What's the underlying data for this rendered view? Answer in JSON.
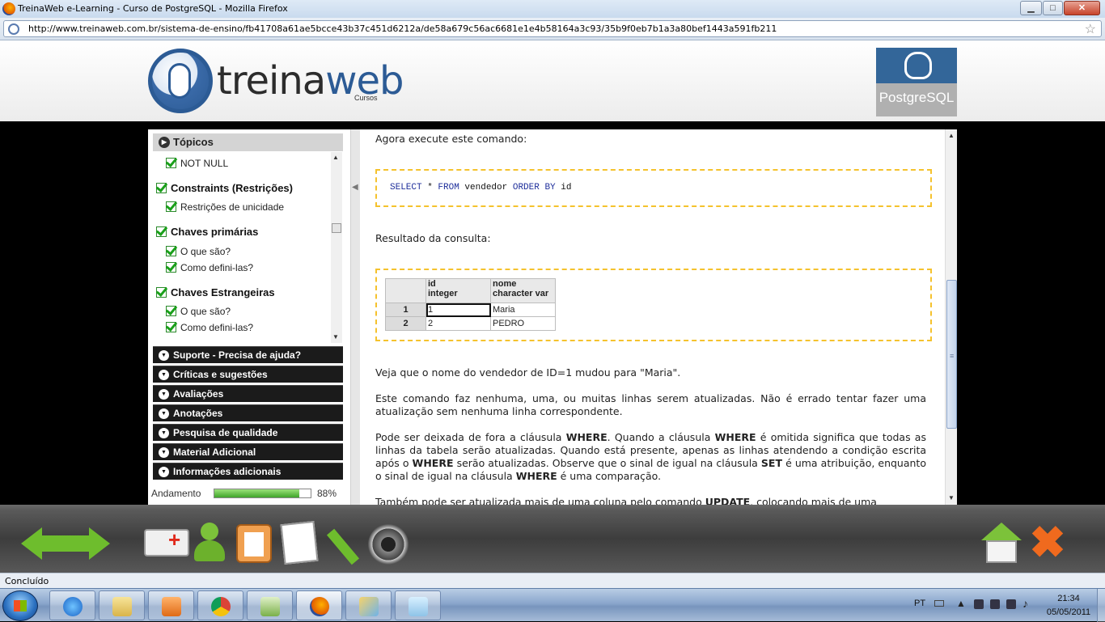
{
  "window": {
    "title": "TreinaWeb e-Learning - Curso de PostgreSQL - Mozilla Firefox",
    "minimize": "▁",
    "maximize": "□",
    "close": "✕"
  },
  "addressbar": {
    "url": "http://www.treinaweb.com.br/sistema-de-ensino/fb41708a61ae5bcce43b37c451d6212a/de58a679c56ac6681e1e4b58164a3c93/35b9f0eb7b1a3a80bef1443a591fb211",
    "bookmark_star": "☆"
  },
  "header": {
    "logo_text_1": "treina",
    "logo_text_2": "web",
    "logo_sub": "Cursos",
    "badge_label": "PostgreSQL"
  },
  "sidebar": {
    "topics_label": "Tópicos",
    "topics": [
      {
        "label": "NOT NULL",
        "group": false
      },
      {
        "label": "Constraints (Restrições)",
        "group": true
      },
      {
        "label": "Restrições de unicidade",
        "group": false
      },
      {
        "label": "Chaves primárias",
        "group": true
      },
      {
        "label": "O que são?",
        "group": false
      },
      {
        "label": "Como defini-las?",
        "group": false
      },
      {
        "label": "Chaves Estrangeiras",
        "group": true
      },
      {
        "label": "O que são?",
        "group": false
      },
      {
        "label": "Como defini-las?",
        "group": false
      }
    ],
    "sections": [
      "Suporte - Precisa de ajuda?",
      "Críticas e sugestões",
      "Avaliações",
      "Anotações",
      "Pesquisa de qualidade",
      "Material Adicional",
      "Informações adicionais"
    ],
    "progress_label": "Andamento",
    "progress_value": 88,
    "progress_text": "88%"
  },
  "content": {
    "intro": "Agora execute este comando:",
    "code": {
      "kw1": "SELECT",
      "rest1": " * ",
      "kw2": "FROM",
      "rest2": " vendedor ",
      "kw3": "ORDER BY",
      "rest3": " id"
    },
    "result_label": "Resultado da consulta:",
    "grid": {
      "columns": [
        {
          "name": "id",
          "type": "integer"
        },
        {
          "name": "nome",
          "type": "character var"
        }
      ],
      "rows": [
        {
          "rownum": "1",
          "id": "1",
          "nome": "Maria"
        },
        {
          "rownum": "2",
          "id": "2",
          "nome": "PEDRO"
        }
      ]
    },
    "para1": "Veja que o nome do vendedor de ID=1 mudou para \"Maria\".",
    "para2": "Este comando faz nenhuma, uma, ou muitas linhas serem atualizadas. Não é errado tentar fazer uma atualização sem nenhuma linha correspondente.",
    "para3_parts": [
      "Pode ser deixada de fora a cláusula ",
      "WHERE",
      ". Quando a cláusula ",
      "WHERE",
      " é omitida significa que todas as linhas da tabela serão atualizadas. Quando está presente, apenas as linhas atendendo a condição escrita após o ",
      "WHERE",
      " serão atualizadas. Observe que o sinal de igual na cláusula ",
      "SET",
      " é uma atribuição, enquanto o sinal de igual na cláusula ",
      "WHERE",
      " é uma comparação."
    ],
    "para4_parts": [
      "Também pode ser atualizada mais de uma coluna pelo comando ",
      "UPDATE",
      ", colocando mais de uma"
    ]
  },
  "navbar": {
    "back": "back-arrow-icon",
    "forward": "forward-arrow-icon",
    "home": "home-icon",
    "close": "close-icon"
  },
  "statusbar": {
    "text": "Concluído"
  },
  "taskbar": {
    "lang": "PT",
    "time": "21:34",
    "date": "05/05/2011"
  },
  "colors": {
    "accent_green": "#6ebd2d",
    "code_border": "#f5c22d",
    "brand_blue": "#2c5b95",
    "postgres_blue": "#336699"
  }
}
